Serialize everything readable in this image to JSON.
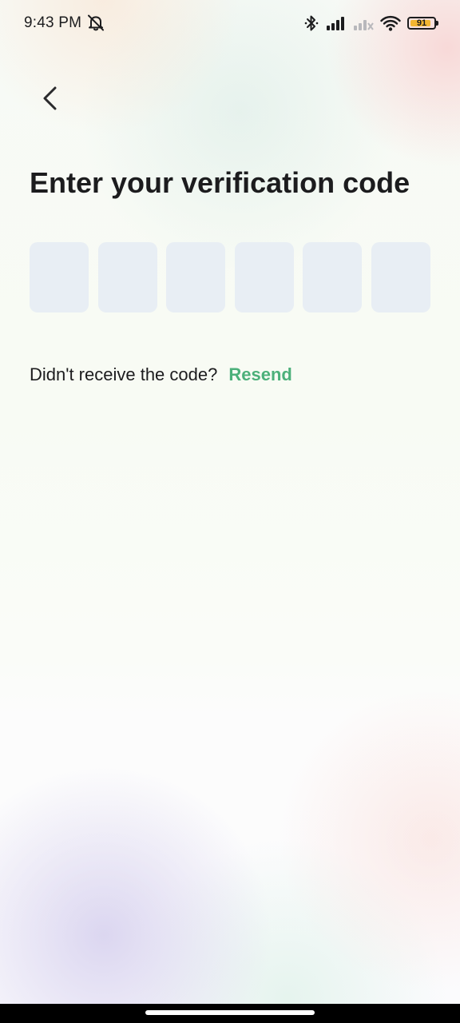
{
  "status_bar": {
    "time": "9:43 PM",
    "left_icon": "bell-off-icon",
    "right_icons": [
      "bluetooth-icon",
      "signal-icon",
      "signal-no-service-icon",
      "wifi-icon"
    ],
    "battery_level": "91",
    "battery_color": "#f2b632"
  },
  "header": {
    "back_icon": "chevron-left-icon"
  },
  "main": {
    "title": "Enter your verification code",
    "code_digits": [
      "",
      "",
      "",
      "",
      "",
      ""
    ],
    "resend_prompt": "Didn't receive the code?",
    "resend_label": "Resend"
  },
  "colors": {
    "accent": "#4cb07a",
    "input_bg": "#e8eef4",
    "text": "#1c1c1e"
  }
}
